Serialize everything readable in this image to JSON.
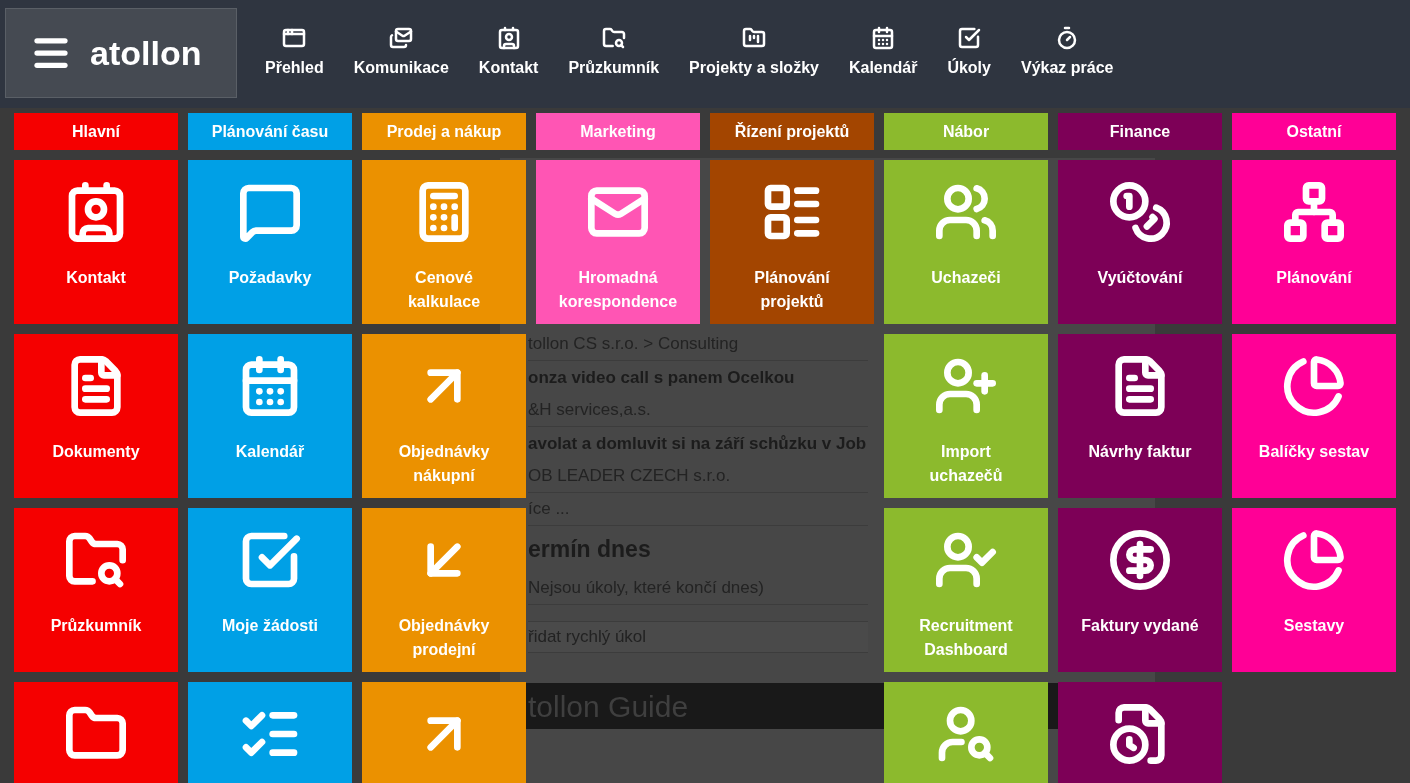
{
  "app": {
    "logo": "atollon"
  },
  "nav": [
    {
      "label": "Přehled"
    },
    {
      "label": "Komunikace"
    },
    {
      "label": "Kontakt"
    },
    {
      "label": "Průzkumník"
    },
    {
      "label": "Projekty a složky"
    },
    {
      "label": "Kalendář"
    },
    {
      "label": "Úkoly"
    },
    {
      "label": "Výkaz práce"
    }
  ],
  "background_panel": {
    "lines": [
      {
        "kind": "plain",
        "text": "tollon CS s.r.o. > Consulting"
      },
      {
        "kind": "bold",
        "text": "onza video call s panem Ocelkou"
      },
      {
        "kind": "plain",
        "text": "&H services,a.s."
      },
      {
        "kind": "bold",
        "text": "avolat a domluvit si na září schůzku v Job"
      },
      {
        "kind": "plain",
        "text": "OB LEADER CZECH s.r.o."
      },
      {
        "kind": "plain",
        "text": "íce ..."
      },
      {
        "kind": "heading",
        "text": "ermín dnes"
      },
      {
        "kind": "plain",
        "text": "Nejsou úkoly, které končí dnes)"
      }
    ],
    "quick_task": {
      "placeholder": "řidat rychlý úkol"
    },
    "guide_title": "tollon Guide"
  },
  "columns": [
    {
      "header": "Hlavní",
      "color": "#f50000",
      "tiles": [
        {
          "kind": "tile",
          "label": "Kontakt"
        },
        {
          "kind": "tile",
          "label": "Dokumenty"
        },
        {
          "kind": "tile",
          "label": "Průzkumník"
        },
        {
          "kind": "tile"
        }
      ]
    },
    {
      "header": "Plánování času",
      "color": "#00a0e6",
      "tiles": [
        {
          "kind": "tile",
          "label": "Požadavky"
        },
        {
          "kind": "tile",
          "label": "Kalendář"
        },
        {
          "kind": "tile",
          "label": "Moje žádosti"
        },
        {
          "kind": "tile"
        }
      ]
    },
    {
      "header": "Prodej a nákup",
      "color": "#eb9100",
      "tiles": [
        {
          "kind": "tile",
          "label": "Cenové kalkulace"
        },
        {
          "kind": "tile",
          "label": "Objednávky nákupní"
        },
        {
          "kind": "tile",
          "label": "Objednávky prodejní"
        },
        {
          "kind": "tile"
        }
      ]
    },
    {
      "header": "Marketing",
      "color": "#ff55b4",
      "tiles": [
        {
          "kind": "tile",
          "label": "Hromadná korespondence"
        }
      ]
    },
    {
      "header": "Řízení projektů",
      "color": "#a34500",
      "tiles": [
        {
          "kind": "tile",
          "label": "Plánování projektů"
        }
      ]
    },
    {
      "header": "Nábor",
      "color": "#8cba2d",
      "tiles": [
        {
          "kind": "tile",
          "label": "Uchazeči"
        },
        {
          "kind": "tile",
          "label": "Import uchazečů"
        },
        {
          "kind": "tile",
          "label": "Recruitment Dashboard"
        },
        {
          "kind": "tile"
        }
      ]
    },
    {
      "header": "Finance",
      "color": "#7d0057",
      "tiles": [
        {
          "kind": "tile",
          "label": "Vyúčtování"
        },
        {
          "kind": "tile",
          "label": "Návrhy faktur"
        },
        {
          "kind": "tile",
          "label": "Faktury vydané"
        },
        {
          "kind": "tile"
        }
      ]
    },
    {
      "header": "Ostatní",
      "color": "#ff0096",
      "tiles": [
        {
          "kind": "tile",
          "label": "Plánování"
        },
        {
          "kind": "tile",
          "label": "Balíčky sestav"
        },
        {
          "kind": "tile",
          "label": "Sestavy"
        }
      ]
    }
  ]
}
